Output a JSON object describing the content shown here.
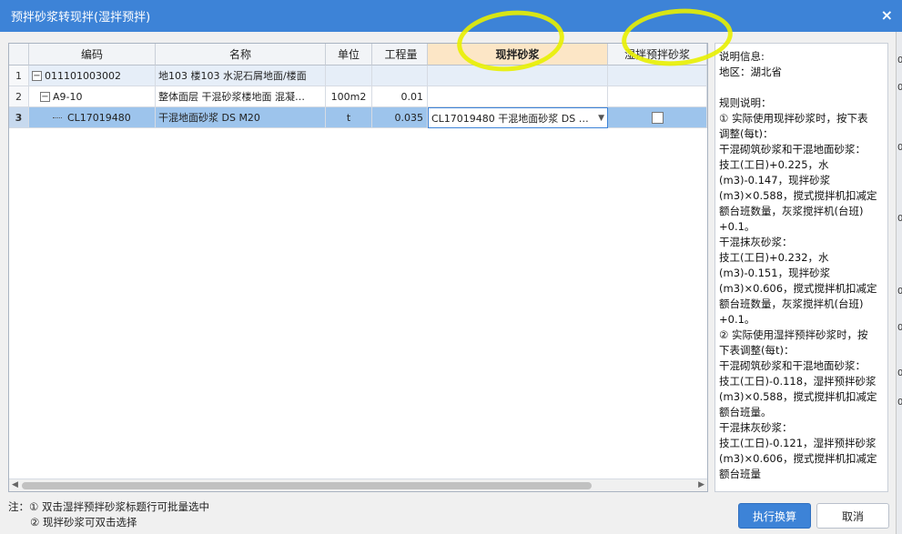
{
  "dialog": {
    "title": "预拌砂浆转现拌(湿拌预拌)",
    "close_label": "×"
  },
  "grid": {
    "columns": [
      "",
      "编码",
      "名称",
      "单位",
      "工程量",
      "现拌砂浆",
      "湿拌预拌砂浆"
    ],
    "rows": [
      {
        "num": "1",
        "code": "011101003002",
        "name": "地103 楼103 水泥石屑地面/楼面",
        "unit": "",
        "qty": "",
        "mortar": "",
        "tree": "−"
      },
      {
        "num": "2",
        "code": "A9-10",
        "name": "整体面层 干混砂浆楼地面 混凝…",
        "unit": "100m2",
        "qty": "0.01",
        "mortar": "",
        "tree": "−"
      },
      {
        "num": "3",
        "code": "CL17019480",
        "name": "干混地面砂浆 DS M20",
        "unit": "t",
        "qty": "0.035",
        "mortar": "CL17019480 干混地面砂浆 DS …",
        "tree": ""
      }
    ]
  },
  "info": {
    "lines": [
      "说明信息:",
      "地区：湖北省",
      "",
      "规则说明：",
      "① 实际使用现拌砂浆时，按下表",
      "调整(每t)：",
      "干混砌筑砂浆和干混地面砂浆：",
      "技工(工日)+0.225，水",
      "(m3)-0.147，现拌砂浆",
      "(m3)×0.588，搅式搅拌机扣减定",
      "额台班数量，灰浆搅拌机(台班)",
      "+0.1。",
      "干混抹灰砂浆：",
      "技工(工日)+0.232，水",
      "(m3)-0.151，现拌砂浆",
      "(m3)×0.606，搅式搅拌机扣减定",
      "额台班数量，灰浆搅拌机(台班)",
      "+0.1。",
      "② 实际使用湿拌预拌砂浆时，按",
      "下表调整(每t)：",
      "干混砌筑砂浆和干混地面砂浆：",
      "技工(工日)-0.118，湿拌预拌砂浆",
      "(m3)×0.588，搅式搅拌机扣减定",
      "额台班量。",
      "干混抹灰砂浆：",
      "技工(工日)-0.121，湿拌预拌砂浆",
      "(m3)×0.606，搅式搅拌机扣减定",
      "额台班量"
    ]
  },
  "notes": {
    "line1": "注：① 双击湿拌预拌砂浆标题行可批量选中",
    "line2": "② 现拌砂浆可双击选择"
  },
  "buttons": {
    "execute": "执行换算",
    "cancel": "取消"
  },
  "right_strip_marks": [
    "0",
    "0",
    "0",
    "0",
    "0",
    "0",
    "0",
    "0"
  ],
  "colors": {
    "titlebar": "#3d83d7",
    "selected_row": "#9dc4ec",
    "active_header": "#fce6c6",
    "highlight": "#e8f000"
  }
}
